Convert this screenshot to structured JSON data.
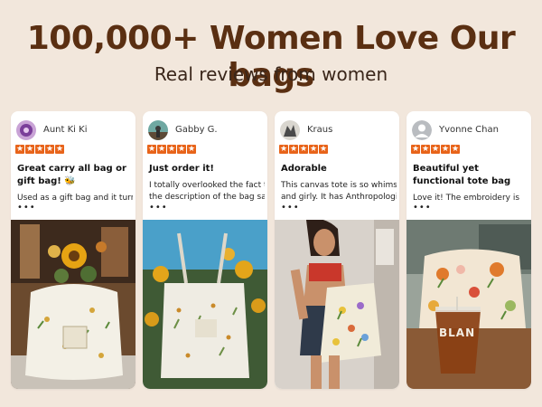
{
  "header": {
    "headline": "100,000+ Women Love Our bags",
    "subheadline": "Real reviews from women"
  },
  "colors": {
    "background": "#f2e7dc",
    "headline": "#5a2f12",
    "star": "#e8641a",
    "card": "#ffffff"
  },
  "reviews": [
    {
      "reviewer": "Aunt Ki Ki",
      "rating": 5,
      "title": "Great carry all bag or gift bag! 🐝",
      "body": "Used as a gift bag and it turned",
      "more": "•••",
      "photo_icon": "sunflower-tote-photo"
    },
    {
      "reviewer": "Gabby G.",
      "rating": 5,
      "title": "Just order it!",
      "body_lines": [
        "I totally overlooked the fact that",
        "the description of the bag says"
      ],
      "more": "•••",
      "photo_icon": "sunflower-field-tote-photo"
    },
    {
      "reviewer": "Kraus",
      "rating": 5,
      "title": "Adorable",
      "body_lines": [
        "This canvas tote is so whimsical",
        "and girly. It has Anthropologie"
      ],
      "more": "•••",
      "photo_icon": "woman-holding-tote-photo"
    },
    {
      "reviewer": "Yvonne Chan",
      "rating": 5,
      "title": "Beautiful yet functional tote bag",
      "body": "Love it! The embroidery is",
      "more": "•••",
      "photo_icon": "tote-with-iced-coffee-photo",
      "cup_text": "BLAN"
    }
  ]
}
